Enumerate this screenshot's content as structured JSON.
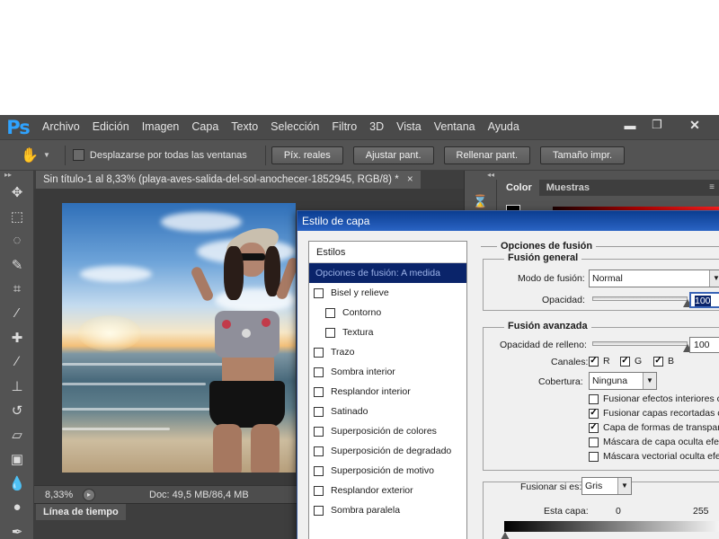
{
  "app": {
    "logo": "Ps",
    "menu": [
      "Archivo",
      "Edición",
      "Imagen",
      "Capa",
      "Texto",
      "Selección",
      "Filtro",
      "3D",
      "Vista",
      "Ventana",
      "Ayuda"
    ],
    "window_controls": {
      "minimize": "▬",
      "restore": "❐",
      "close": "✕"
    }
  },
  "options_bar": {
    "scroll_all_label": "Desplazarse por todas las ventanas",
    "buttons": [
      "Píx. reales",
      "Ajustar pant.",
      "Rellenar pant.",
      "Tamaño impr."
    ]
  },
  "toolbar": {
    "tools": [
      "move-icon",
      "marquee-icon",
      "lasso-icon",
      "quick-select-icon",
      "crop-icon",
      "eyedropper-icon",
      "healing-icon",
      "brush-icon",
      "stamp-icon",
      "history-brush-icon",
      "eraser-icon",
      "gradient-icon",
      "blur-icon",
      "dodge-icon",
      "pen-icon"
    ]
  },
  "document": {
    "tab_title": "Sin título-1 al 8,33% (playa-aves-salida-del-sol-anochecer-1852945, RGB/8) *",
    "tab_close": "×",
    "zoom": "8,33%",
    "doc_info": "Doc: 49,5 MB/86,4 MB"
  },
  "timeline": {
    "tab": "Línea de tiempo"
  },
  "right_panel": {
    "tabs": [
      "Color",
      "Muestras"
    ],
    "menu_icon": "≡"
  },
  "dialog": {
    "title": "Estilo de capa",
    "styles_header": "Estilos",
    "styles": [
      {
        "label": "Opciones de fusión: A medida",
        "active": true,
        "checkbox": false,
        "sub": false
      },
      {
        "label": "Bisel y relieve",
        "active": false,
        "checkbox": true,
        "sub": false
      },
      {
        "label": "Contorno",
        "active": false,
        "checkbox": true,
        "sub": true
      },
      {
        "label": "Textura",
        "active": false,
        "checkbox": true,
        "sub": true
      },
      {
        "label": "Trazo",
        "active": false,
        "checkbox": true,
        "sub": false
      },
      {
        "label": "Sombra interior",
        "active": false,
        "checkbox": true,
        "sub": false
      },
      {
        "label": "Resplandor interior",
        "active": false,
        "checkbox": true,
        "sub": false
      },
      {
        "label": "Satinado",
        "active": false,
        "checkbox": true,
        "sub": false
      },
      {
        "label": "Superposición de colores",
        "active": false,
        "checkbox": true,
        "sub": false
      },
      {
        "label": "Superposición de degradado",
        "active": false,
        "checkbox": true,
        "sub": false
      },
      {
        "label": "Superposición de motivo",
        "active": false,
        "checkbox": true,
        "sub": false
      },
      {
        "label": "Resplandor exterior",
        "active": false,
        "checkbox": true,
        "sub": false
      },
      {
        "label": "Sombra paralela",
        "active": false,
        "checkbox": true,
        "sub": false
      }
    ],
    "blend_options_title": "Opciones de fusión",
    "general": {
      "title": "Fusión general",
      "mode_label": "Modo de fusión:",
      "mode_value": "Normal",
      "opacity_label": "Opacidad:",
      "opacity_value": "100",
      "opacity_level": 1.0
    },
    "advanced": {
      "title": "Fusión avanzada",
      "fill_opacity_label": "Opacidad de relleno:",
      "fill_opacity_value": "100",
      "fill_opacity_level": 1.0,
      "channels_label": "Canales:",
      "channels": [
        {
          "label": "R",
          "checked": true
        },
        {
          "label": "G",
          "checked": true
        },
        {
          "label": "B",
          "checked": true
        }
      ],
      "knockout_label": "Cobertura:",
      "knockout_value": "Ninguna",
      "options": [
        {
          "label": "Fusionar efectos interiores co",
          "checked": false
        },
        {
          "label": "Fusionar capas recortadas co",
          "checked": true
        },
        {
          "label": "Capa de formas de transparen",
          "checked": true
        },
        {
          "label": "Máscara de capa oculta efecto",
          "checked": false
        },
        {
          "label": "Máscara vectorial oculta efec",
          "checked": false
        }
      ]
    },
    "blend_if": {
      "label": "Fusionar si es:",
      "value": "Gris",
      "this_layer_label": "Esta capa:",
      "min": "0",
      "max": "255"
    }
  }
}
